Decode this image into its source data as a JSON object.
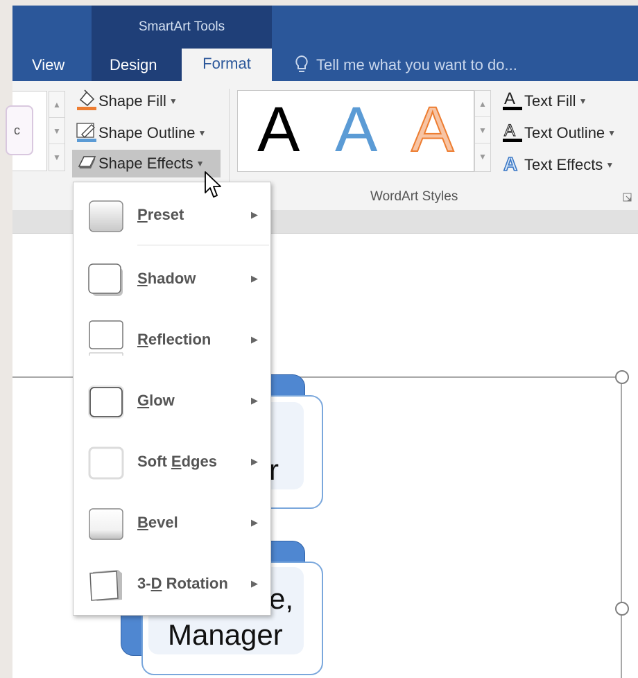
{
  "contextual_tab": {
    "label": "SmartArt Tools"
  },
  "tabs": [
    {
      "label": "View"
    },
    {
      "label": "Design"
    },
    {
      "label": "Format",
      "active": true
    }
  ],
  "tell_me": {
    "placeholder": "Tell me what you want to do..."
  },
  "shape_styles_group": {
    "gallery_preview_letters": "c",
    "buttons": [
      {
        "label": "Shape Fill",
        "icon": "paint-bucket-icon"
      },
      {
        "label": "Shape Outline",
        "icon": "pencil-outline-icon"
      },
      {
        "label": "Shape Effects",
        "icon": "shape-effects-icon",
        "state": "pressed"
      }
    ]
  },
  "wordart_group": {
    "label": "WordArt Styles",
    "gallery": [
      {
        "glyph": "A",
        "style": "black fill"
      },
      {
        "glyph": "A",
        "style": "blue fill"
      },
      {
        "glyph": "A",
        "style": "orange outline"
      }
    ],
    "buttons": [
      {
        "label": "Text Fill",
        "icon": "text-fill-icon"
      },
      {
        "label": "Text Outline",
        "icon": "text-outline-icon"
      },
      {
        "label": "Text Effects",
        "icon": "text-effects-icon"
      }
    ]
  },
  "shape_effects_menu": {
    "items": [
      {
        "pre": "",
        "key": "P",
        "post": "reset"
      },
      {
        "pre": "",
        "key": "S",
        "post": "hadow"
      },
      {
        "pre": "",
        "key": "R",
        "post": "eflection"
      },
      {
        "pre": "",
        "key": "G",
        "post": "low"
      },
      {
        "pre": "Soft ",
        "key": "E",
        "post": "dges"
      },
      {
        "pre": "",
        "key": "B",
        "post": "evel"
      },
      {
        "pre": "3-",
        "key": "D",
        "post": " Rotation"
      }
    ]
  },
  "document": {
    "card_top_text": "r",
    "card_bottom_line1": "e,",
    "card_bottom_line2": "Manager"
  },
  "colors": {
    "ribbon_blue": "#2b579a",
    "contextual_blue": "#1f3f78",
    "smartart_accent": "#4f87d1"
  }
}
